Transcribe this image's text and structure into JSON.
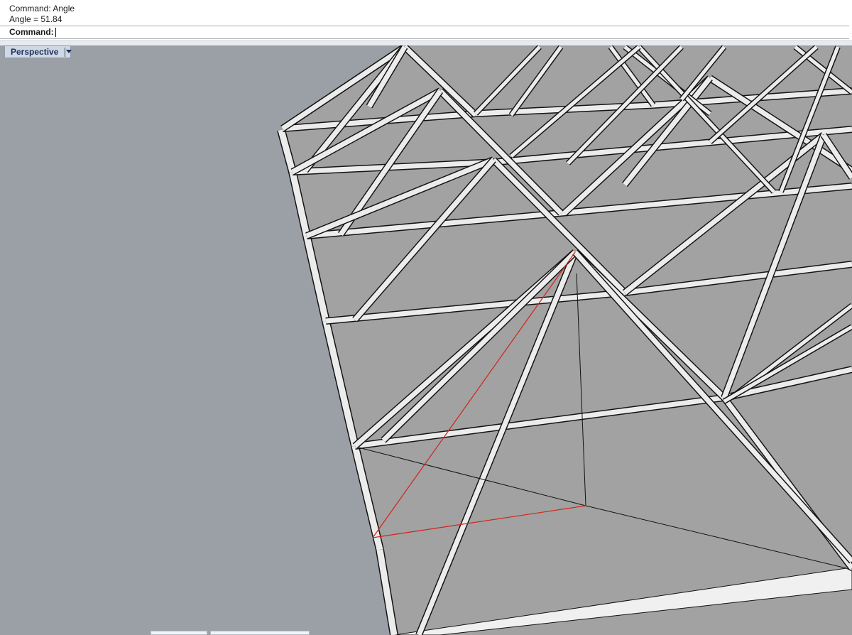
{
  "command_area": {
    "history": [
      "Command: Angle",
      "Angle = 51.84"
    ],
    "prompt_label": "Command:",
    "input_value": ""
  },
  "viewport": {
    "name": "Perspective",
    "dropdown_icon": "chevron-down-icon",
    "background_color": "#9aa0a6",
    "surface_color": "#a2a2a2",
    "member_color": "#ececec",
    "highlight_line_color": "#d0251b"
  }
}
